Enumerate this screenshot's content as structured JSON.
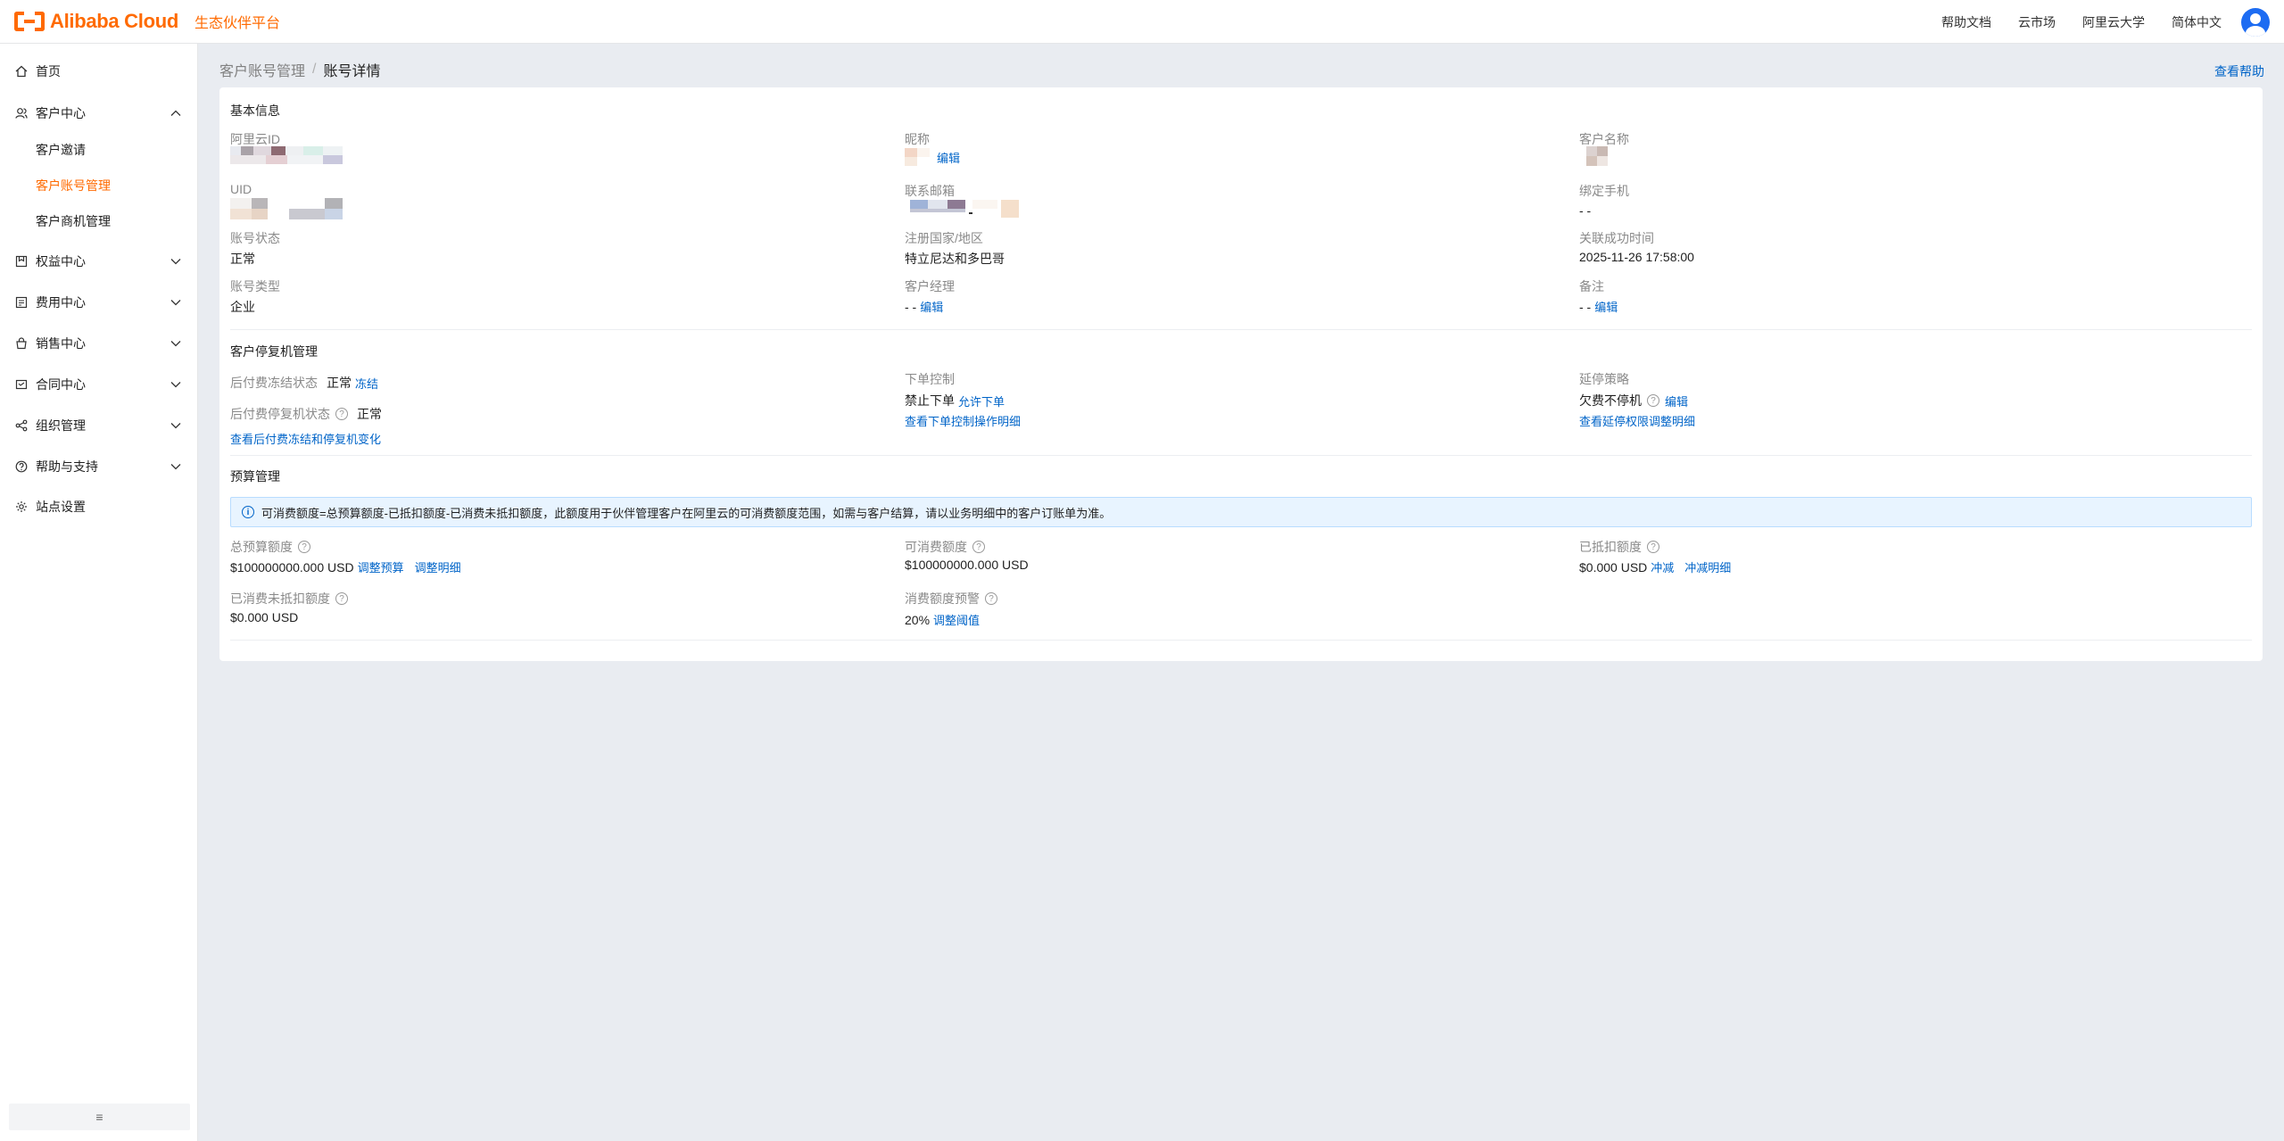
{
  "header": {
    "logo_text": "Alibaba Cloud",
    "platform_name": "生态伙伴平台",
    "links": [
      "帮助文档",
      "云市场",
      "阿里云大学",
      "简体中文"
    ],
    "brand_color": "#ff6a00"
  },
  "sidebar": {
    "items": [
      {
        "label": "首页",
        "icon": "home-icon"
      },
      {
        "label": "客户中心",
        "icon": "customer-icon",
        "expanded": true,
        "children": [
          "客户邀请",
          "客户账号管理",
          "客户商机管理"
        ],
        "active_child": "客户账号管理"
      },
      {
        "label": "权益中心",
        "icon": "benefit-icon"
      },
      {
        "label": "费用中心",
        "icon": "billing-icon"
      },
      {
        "label": "销售中心",
        "icon": "sales-icon"
      },
      {
        "label": "合同中心",
        "icon": "contract-icon"
      },
      {
        "label": "组织管理",
        "icon": "organization-icon"
      },
      {
        "label": "帮助与支持",
        "icon": "help-icon"
      },
      {
        "label": "站点设置",
        "icon": "settings-icon"
      }
    ],
    "collapse_glyph": "≡"
  },
  "breadcrumb": {
    "parent": "客户账号管理",
    "separator": "/",
    "current": "账号详情"
  },
  "help_link": "查看帮助",
  "basic_info": {
    "title": "基本信息",
    "aliyun_id_label": "阿里云ID",
    "nickname_label": "昵称",
    "nickname_edit": "编辑",
    "customer_name_label": "客户名称",
    "uid_label": "UID",
    "email_label": "联系邮箱",
    "phone_label": "绑定手机",
    "phone_value": "- -",
    "status_label": "账号状态",
    "status_value": "正常",
    "country_label": "注册国家/地区",
    "country_value": "特立尼达和多巴哥",
    "linked_time_label": "关联成功时间",
    "linked_time_value": "2025-11-26 17:58:00",
    "type_label": "账号类型",
    "type_value": "企业",
    "manager_label": "客户经理",
    "manager_value": "- -",
    "manager_edit": "编辑",
    "remark_label": "备注",
    "remark_value": "- -",
    "remark_edit": "编辑"
  },
  "suspension": {
    "title": "客户停复机管理",
    "freeze_label": "后付费冻结状态",
    "freeze_value": "正常",
    "freeze_link": "冻结",
    "resume_label": "后付费停复机状态",
    "resume_value": "正常",
    "history_link": "查看后付费冻结和停复机变化",
    "order_label": "下单控制",
    "order_value": "禁止下单",
    "order_link": "允许下单",
    "order_detail_link": "查看下单控制操作明细",
    "delay_label": "延停策略",
    "delay_value": "欠费不停机",
    "delay_edit": "编辑",
    "delay_detail_link": "查看延停权限调整明细"
  },
  "budget": {
    "title": "预算管理",
    "notice": "可消费额度=总预算额度-已抵扣额度-已消费未抵扣额度，此额度用于伙伴管理客户在阿里云的可消费额度范围，如需与客户结算，请以业务明细中的客户订账单为准。",
    "total_label": "总预算额度",
    "total_value": "$100000000.000 USD",
    "total_adjust_link": "调整预算",
    "total_detail_link": "调整明细",
    "available_label": "可消费额度",
    "available_value": "$100000000.000 USD",
    "deducted_label": "已抵扣额度",
    "deducted_value": "$0.000 USD",
    "deducted_offset_link": "冲减",
    "deducted_detail_link": "冲减明细",
    "consumed_label": "已消费未抵扣额度",
    "consumed_value": "$0.000 USD",
    "alert_label": "消费额度预警",
    "alert_value": "20%",
    "alert_link": "调整阈值"
  }
}
